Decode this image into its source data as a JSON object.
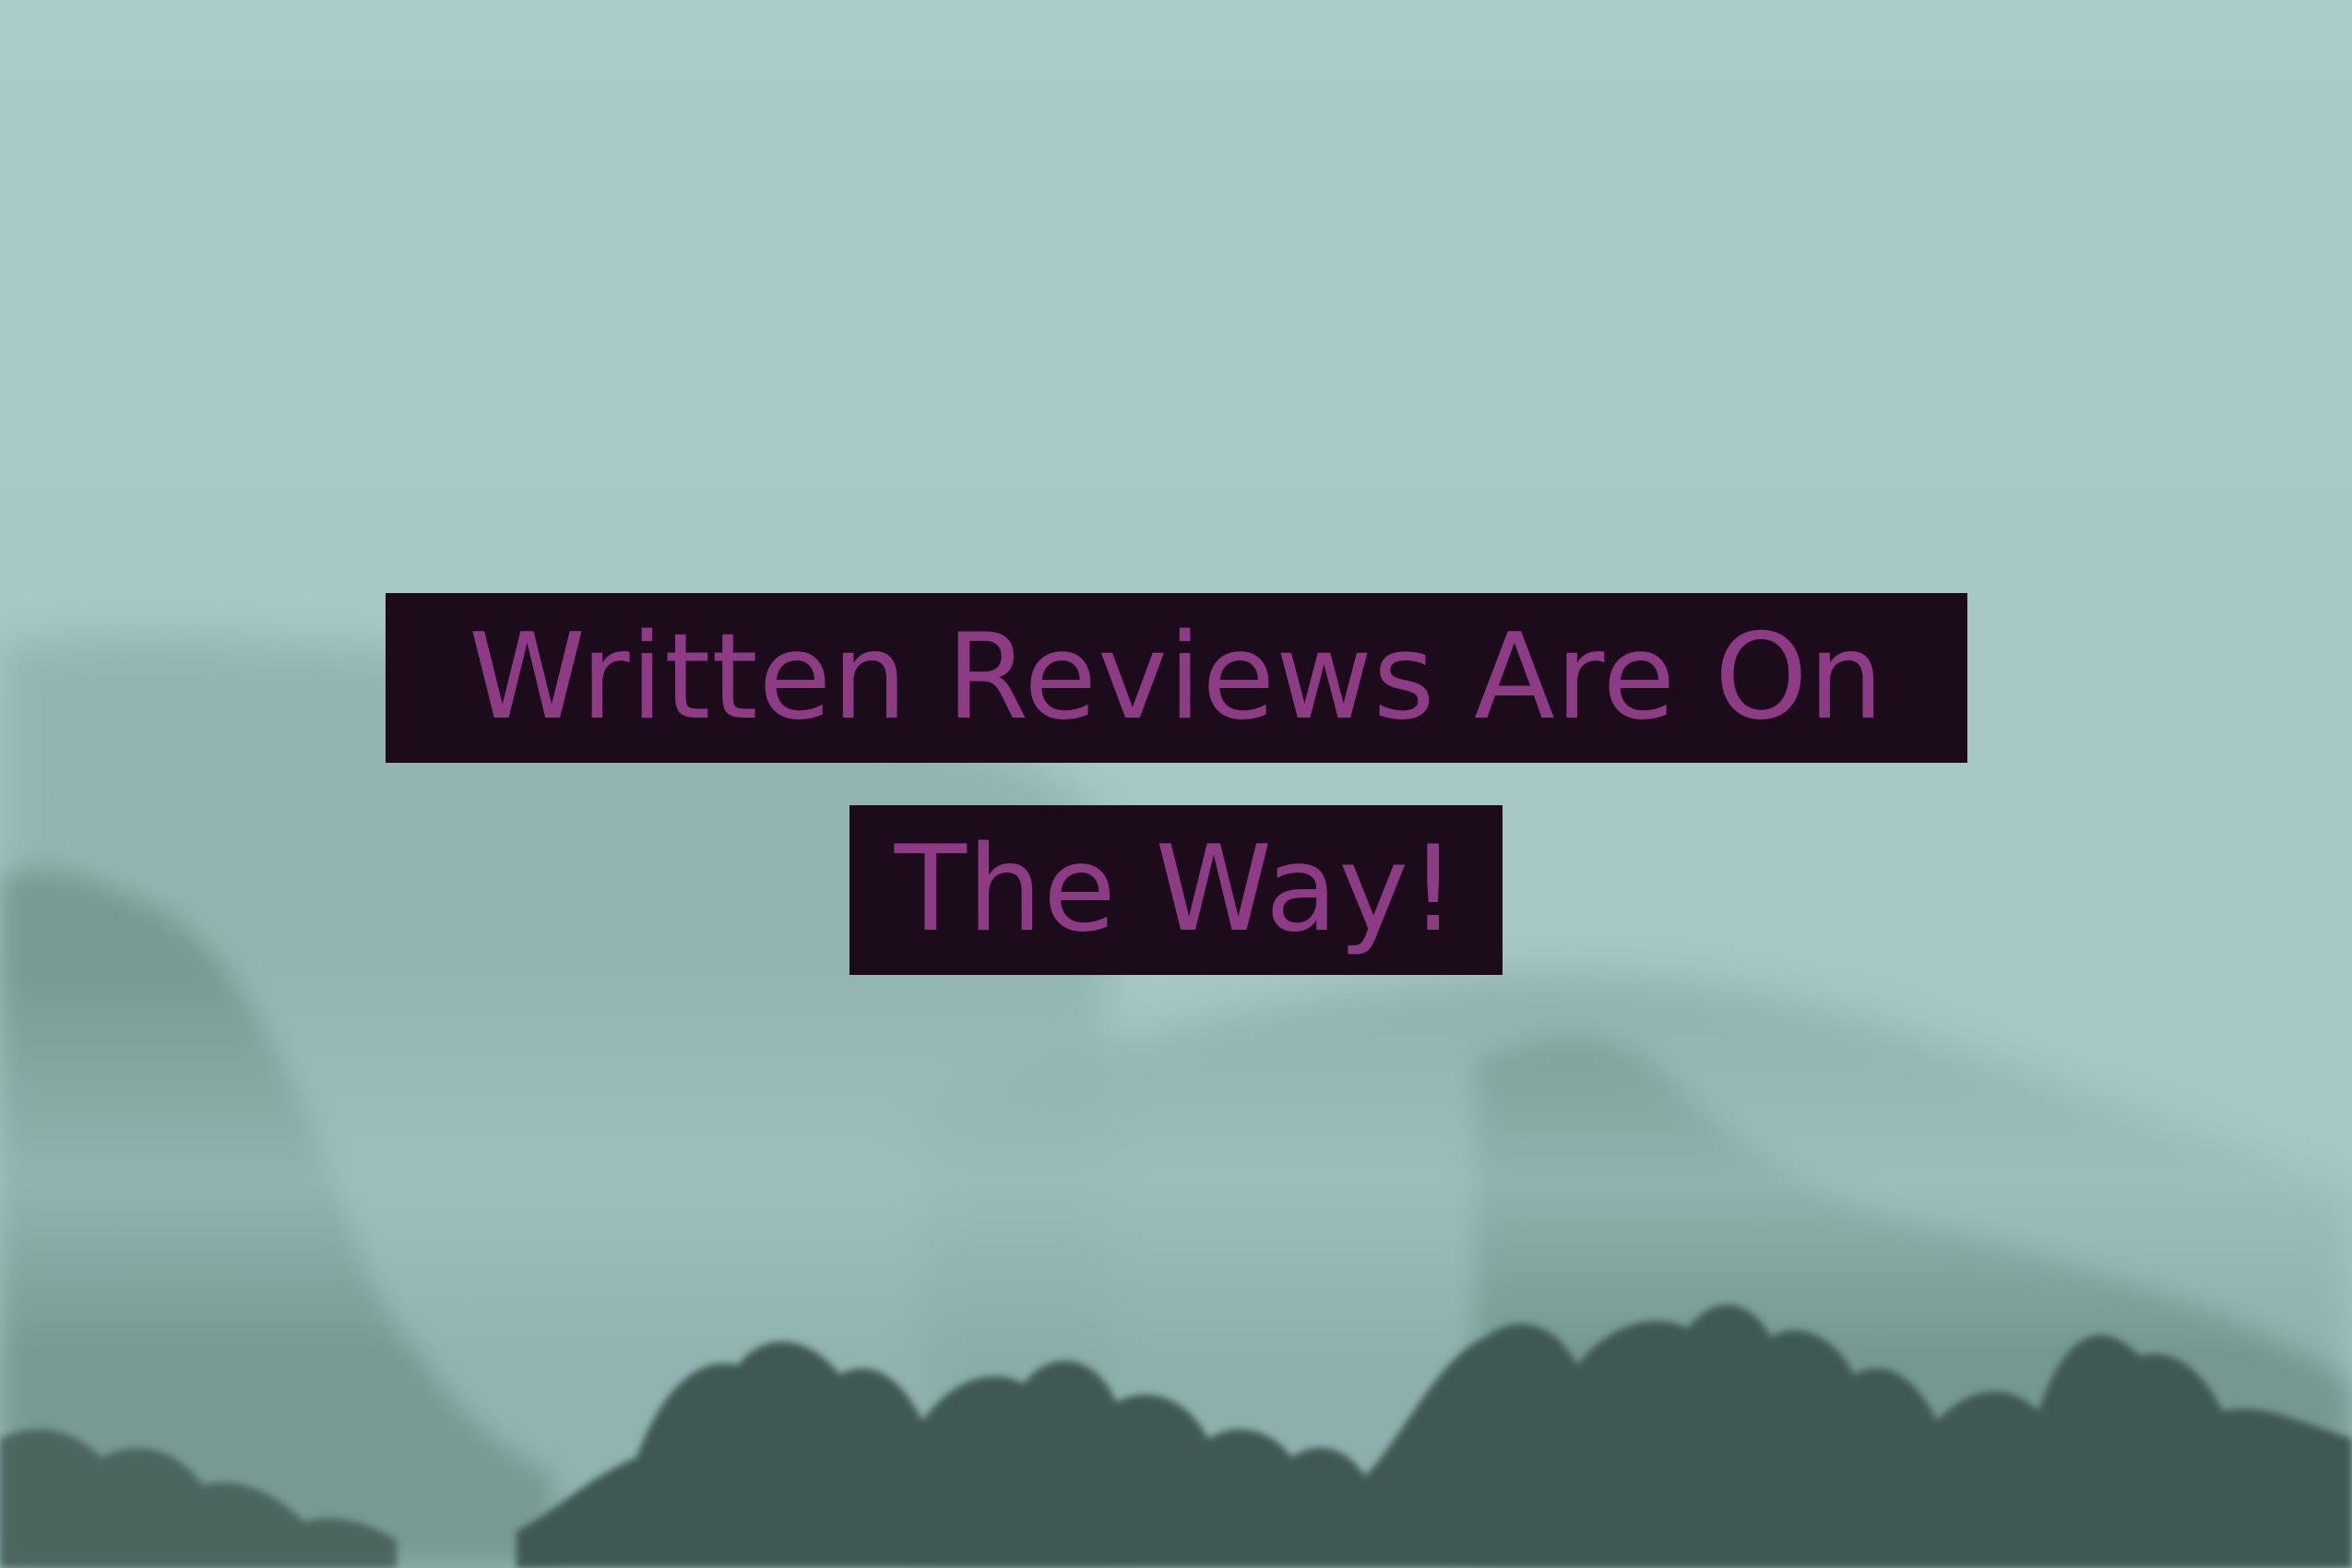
{
  "headline": {
    "line1": "Written Reviews Are On",
    "line2": "The Way!"
  },
  "colors": {
    "sky": "#a6c8c6",
    "banner_background": "#1c0b1a",
    "headline_text": "#8e3b85",
    "far_hills": "#8fb2ae",
    "mid_hills": "#6f918b",
    "near_trees": "#3f5852"
  }
}
